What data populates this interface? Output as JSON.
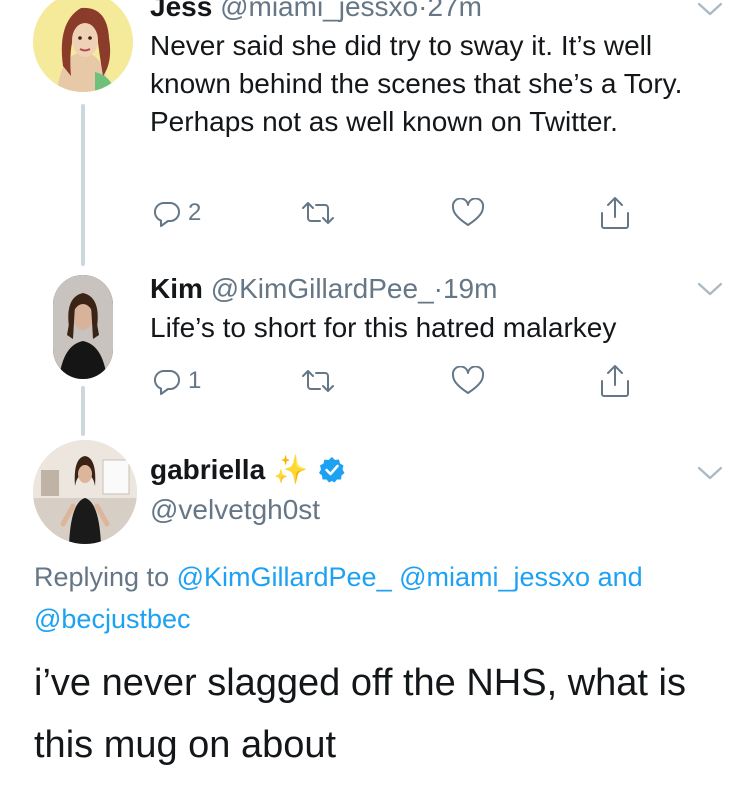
{
  "tweets": [
    {
      "name": "Jess",
      "handle": "@miami_jessxo",
      "separator": "·",
      "time": "27m",
      "text": "Never said she did try to sway it. It’s well known behind the scenes that she’s a Tory. Perhaps not as well known on Twitter.",
      "reply_count": "2"
    },
    {
      "name": "Kim",
      "handle": "@KimGillardPee_",
      "separator": "·",
      "time": "19m",
      "text": "Life’s to short for this hatred malarkey",
      "reply_count": "1"
    }
  ],
  "focused": {
    "name": "gabriella",
    "sparkle": "✨",
    "handle": "@velvetgh0st",
    "replying_prefix": "Replying to",
    "mention_1": "@KimGillardPee_",
    "mention_2": "@miami_jessxo",
    "and_word": "and",
    "mention_3": "@becjustbec",
    "text": "i’ve never slagged off the NHS, what is this mug on about"
  },
  "colors": {
    "link": "#1da1f2",
    "muted": "#657786",
    "thread_line": "#ccd6dd",
    "verified": "#1da1f2"
  },
  "icons": [
    "reply-icon",
    "retweet-icon",
    "like-icon",
    "share-icon",
    "chevron-down-icon",
    "verified-badge-icon"
  ]
}
